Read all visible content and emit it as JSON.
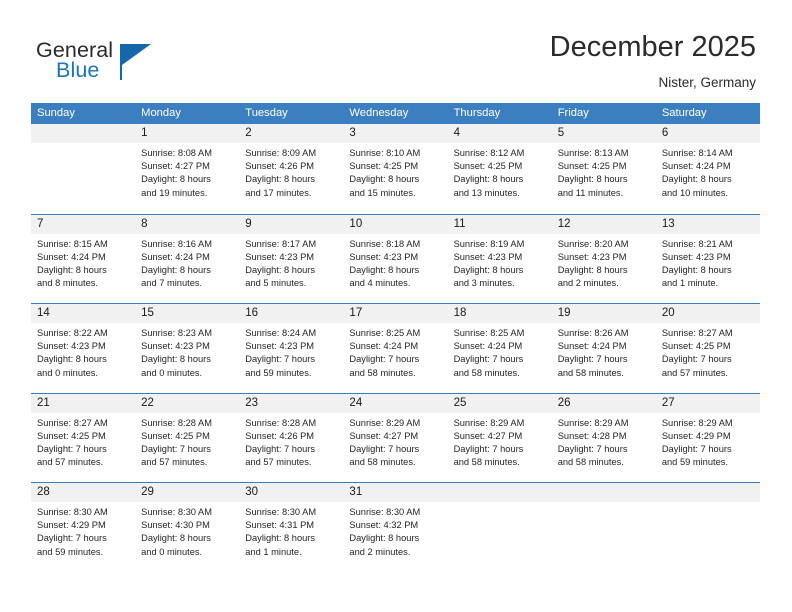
{
  "brand": {
    "name_primary": "General",
    "name_secondary": "Blue",
    "triangle_color": "#1566ab",
    "accent_color": "#3c7fc1"
  },
  "header": {
    "title": "December 2025",
    "location": "Nister, Germany"
  },
  "calendar": {
    "weekdays": [
      "Sunday",
      "Monday",
      "Tuesday",
      "Wednesday",
      "Thursday",
      "Friday",
      "Saturday"
    ],
    "weeks": [
      [
        {
          "day": "",
          "sunrise": "",
          "sunset": "",
          "daylight_line1": "",
          "daylight_line2": ""
        },
        {
          "day": "1",
          "sunrise": "Sunrise: 8:08 AM",
          "sunset": "Sunset: 4:27 PM",
          "daylight_line1": "Daylight: 8 hours",
          "daylight_line2": "and 19 minutes."
        },
        {
          "day": "2",
          "sunrise": "Sunrise: 8:09 AM",
          "sunset": "Sunset: 4:26 PM",
          "daylight_line1": "Daylight: 8 hours",
          "daylight_line2": "and 17 minutes."
        },
        {
          "day": "3",
          "sunrise": "Sunrise: 8:10 AM",
          "sunset": "Sunset: 4:25 PM",
          "daylight_line1": "Daylight: 8 hours",
          "daylight_line2": "and 15 minutes."
        },
        {
          "day": "4",
          "sunrise": "Sunrise: 8:12 AM",
          "sunset": "Sunset: 4:25 PM",
          "daylight_line1": "Daylight: 8 hours",
          "daylight_line2": "and 13 minutes."
        },
        {
          "day": "5",
          "sunrise": "Sunrise: 8:13 AM",
          "sunset": "Sunset: 4:25 PM",
          "daylight_line1": "Daylight: 8 hours",
          "daylight_line2": "and 11 minutes."
        },
        {
          "day": "6",
          "sunrise": "Sunrise: 8:14 AM",
          "sunset": "Sunset: 4:24 PM",
          "daylight_line1": "Daylight: 8 hours",
          "daylight_line2": "and 10 minutes."
        }
      ],
      [
        {
          "day": "7",
          "sunrise": "Sunrise: 8:15 AM",
          "sunset": "Sunset: 4:24 PM",
          "daylight_line1": "Daylight: 8 hours",
          "daylight_line2": "and 8 minutes."
        },
        {
          "day": "8",
          "sunrise": "Sunrise: 8:16 AM",
          "sunset": "Sunset: 4:24 PM",
          "daylight_line1": "Daylight: 8 hours",
          "daylight_line2": "and 7 minutes."
        },
        {
          "day": "9",
          "sunrise": "Sunrise: 8:17 AM",
          "sunset": "Sunset: 4:23 PM",
          "daylight_line1": "Daylight: 8 hours",
          "daylight_line2": "and 5 minutes."
        },
        {
          "day": "10",
          "sunrise": "Sunrise: 8:18 AM",
          "sunset": "Sunset: 4:23 PM",
          "daylight_line1": "Daylight: 8 hours",
          "daylight_line2": "and 4 minutes."
        },
        {
          "day": "11",
          "sunrise": "Sunrise: 8:19 AM",
          "sunset": "Sunset: 4:23 PM",
          "daylight_line1": "Daylight: 8 hours",
          "daylight_line2": "and 3 minutes."
        },
        {
          "day": "12",
          "sunrise": "Sunrise: 8:20 AM",
          "sunset": "Sunset: 4:23 PM",
          "daylight_line1": "Daylight: 8 hours",
          "daylight_line2": "and 2 minutes."
        },
        {
          "day": "13",
          "sunrise": "Sunrise: 8:21 AM",
          "sunset": "Sunset: 4:23 PM",
          "daylight_line1": "Daylight: 8 hours",
          "daylight_line2": "and 1 minute."
        }
      ],
      [
        {
          "day": "14",
          "sunrise": "Sunrise: 8:22 AM",
          "sunset": "Sunset: 4:23 PM",
          "daylight_line1": "Daylight: 8 hours",
          "daylight_line2": "and 0 minutes."
        },
        {
          "day": "15",
          "sunrise": "Sunrise: 8:23 AM",
          "sunset": "Sunset: 4:23 PM",
          "daylight_line1": "Daylight: 8 hours",
          "daylight_line2": "and 0 minutes."
        },
        {
          "day": "16",
          "sunrise": "Sunrise: 8:24 AM",
          "sunset": "Sunset: 4:23 PM",
          "daylight_line1": "Daylight: 7 hours",
          "daylight_line2": "and 59 minutes."
        },
        {
          "day": "17",
          "sunrise": "Sunrise: 8:25 AM",
          "sunset": "Sunset: 4:24 PM",
          "daylight_line1": "Daylight: 7 hours",
          "daylight_line2": "and 58 minutes."
        },
        {
          "day": "18",
          "sunrise": "Sunrise: 8:25 AM",
          "sunset": "Sunset: 4:24 PM",
          "daylight_line1": "Daylight: 7 hours",
          "daylight_line2": "and 58 minutes."
        },
        {
          "day": "19",
          "sunrise": "Sunrise: 8:26 AM",
          "sunset": "Sunset: 4:24 PM",
          "daylight_line1": "Daylight: 7 hours",
          "daylight_line2": "and 58 minutes."
        },
        {
          "day": "20",
          "sunrise": "Sunrise: 8:27 AM",
          "sunset": "Sunset: 4:25 PM",
          "daylight_line1": "Daylight: 7 hours",
          "daylight_line2": "and 57 minutes."
        }
      ],
      [
        {
          "day": "21",
          "sunrise": "Sunrise: 8:27 AM",
          "sunset": "Sunset: 4:25 PM",
          "daylight_line1": "Daylight: 7 hours",
          "daylight_line2": "and 57 minutes."
        },
        {
          "day": "22",
          "sunrise": "Sunrise: 8:28 AM",
          "sunset": "Sunset: 4:25 PM",
          "daylight_line1": "Daylight: 7 hours",
          "daylight_line2": "and 57 minutes."
        },
        {
          "day": "23",
          "sunrise": "Sunrise: 8:28 AM",
          "sunset": "Sunset: 4:26 PM",
          "daylight_line1": "Daylight: 7 hours",
          "daylight_line2": "and 57 minutes."
        },
        {
          "day": "24",
          "sunrise": "Sunrise: 8:29 AM",
          "sunset": "Sunset: 4:27 PM",
          "daylight_line1": "Daylight: 7 hours",
          "daylight_line2": "and 58 minutes."
        },
        {
          "day": "25",
          "sunrise": "Sunrise: 8:29 AM",
          "sunset": "Sunset: 4:27 PM",
          "daylight_line1": "Daylight: 7 hours",
          "daylight_line2": "and 58 minutes."
        },
        {
          "day": "26",
          "sunrise": "Sunrise: 8:29 AM",
          "sunset": "Sunset: 4:28 PM",
          "daylight_line1": "Daylight: 7 hours",
          "daylight_line2": "and 58 minutes."
        },
        {
          "day": "27",
          "sunrise": "Sunrise: 8:29 AM",
          "sunset": "Sunset: 4:29 PM",
          "daylight_line1": "Daylight: 7 hours",
          "daylight_line2": "and 59 minutes."
        }
      ],
      [
        {
          "day": "28",
          "sunrise": "Sunrise: 8:30 AM",
          "sunset": "Sunset: 4:29 PM",
          "daylight_line1": "Daylight: 7 hours",
          "daylight_line2": "and 59 minutes."
        },
        {
          "day": "29",
          "sunrise": "Sunrise: 8:30 AM",
          "sunset": "Sunset: 4:30 PM",
          "daylight_line1": "Daylight: 8 hours",
          "daylight_line2": "and 0 minutes."
        },
        {
          "day": "30",
          "sunrise": "Sunrise: 8:30 AM",
          "sunset": "Sunset: 4:31 PM",
          "daylight_line1": "Daylight: 8 hours",
          "daylight_line2": "and 1 minute."
        },
        {
          "day": "31",
          "sunrise": "Sunrise: 8:30 AM",
          "sunset": "Sunset: 4:32 PM",
          "daylight_line1": "Daylight: 8 hours",
          "daylight_line2": "and 2 minutes."
        },
        {
          "day": "",
          "sunrise": "",
          "sunset": "",
          "daylight_line1": "",
          "daylight_line2": ""
        },
        {
          "day": "",
          "sunrise": "",
          "sunset": "",
          "daylight_line1": "",
          "daylight_line2": ""
        },
        {
          "day": "",
          "sunrise": "",
          "sunset": "",
          "daylight_line1": "",
          "daylight_line2": ""
        }
      ]
    ]
  }
}
